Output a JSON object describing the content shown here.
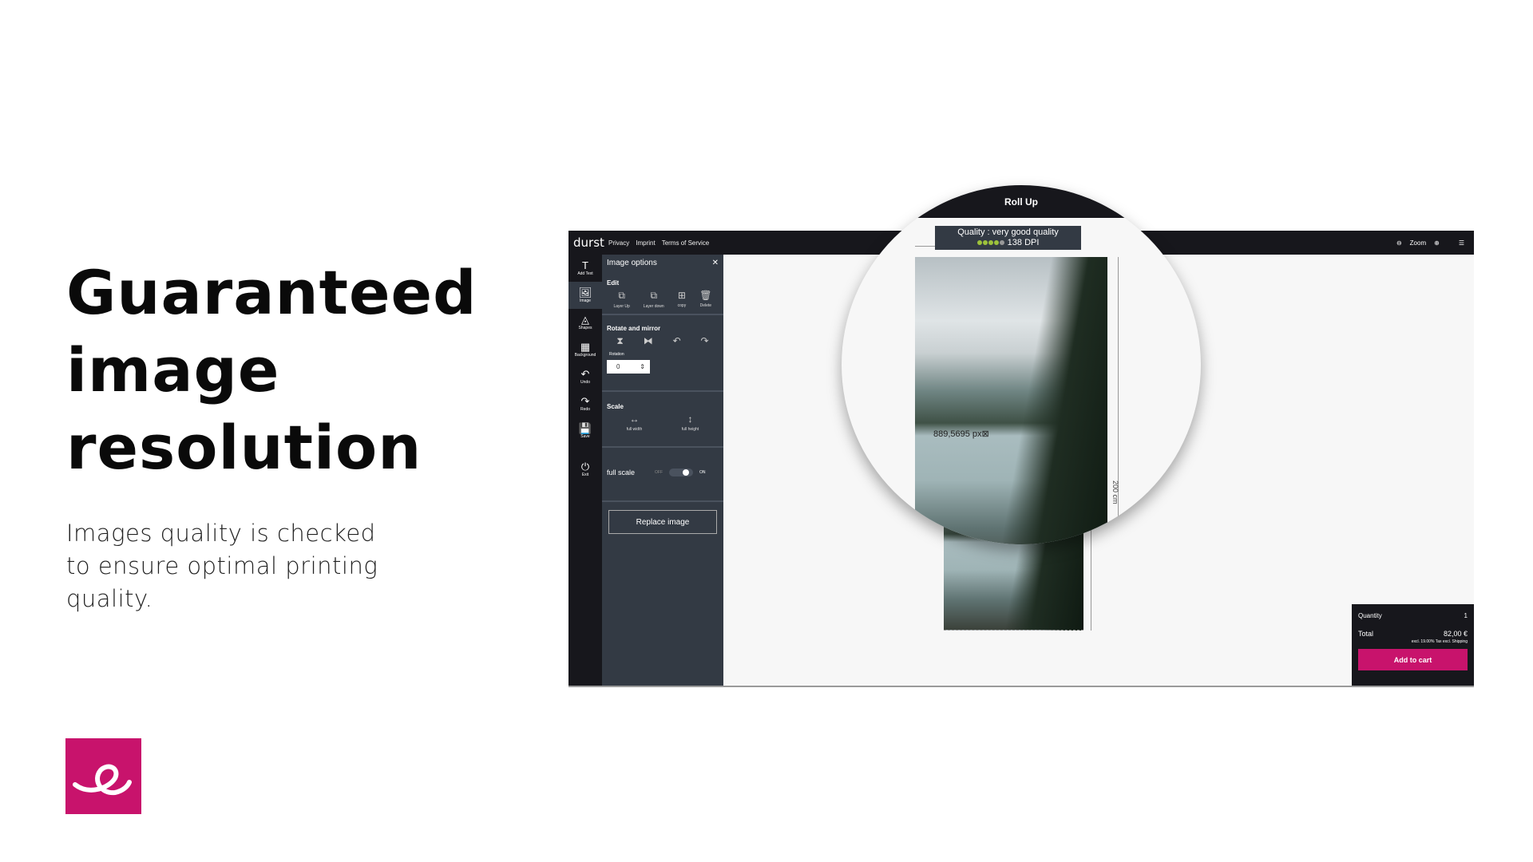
{
  "slide": {
    "headline": [
      "Guaranteed",
      "image",
      "resolution"
    ],
    "subtitle": "Images quality is checked to ensure optimal printing quality.",
    "logo_text": "e",
    "brand_color": "#c8136c"
  },
  "app": {
    "brand": "durst",
    "links": [
      "Privacy",
      "Imprint",
      "Terms of Service"
    ],
    "zoom_label": "Zoom",
    "tools": [
      {
        "label": "Add Text",
        "icon": "T"
      },
      {
        "label": "Image",
        "icon": "🖼"
      },
      {
        "label": "Shapes",
        "icon": "◬"
      },
      {
        "label": "Background",
        "icon": "▦"
      },
      {
        "label": "Undo",
        "icon": "↶"
      },
      {
        "label": "Redo",
        "icon": "↷"
      },
      {
        "label": "Save",
        "icon": "💾"
      },
      {
        "label": "Exit",
        "icon": "⏻"
      }
    ],
    "panel": {
      "title": "Image options",
      "edit_title": "Edit",
      "edit_buttons": [
        {
          "label": "Layer Up",
          "icon": "⧉"
        },
        {
          "label": "Layer down",
          "icon": "⧉"
        },
        {
          "label": "copy",
          "icon": "⊞"
        },
        {
          "label": "Delete",
          "icon": "🗑"
        }
      ],
      "rotate_title": "Rotate and mirror",
      "rotate_icons": [
        "⧗",
        "⧓",
        "↶",
        "↷"
      ],
      "rotation_label": "Rotation",
      "rotation_value": "0",
      "scale_title": "Scale",
      "scale_buttons": [
        {
          "label": "full width",
          "icon": "↔"
        },
        {
          "label": "full height",
          "icon": "↕"
        }
      ],
      "full_scale_label": "full scale",
      "off": "OFF",
      "on": "ON",
      "full_scale_on": true,
      "replace_label": "Replace image"
    },
    "product_title": "Roll Up",
    "quality": {
      "text": "Quality : very good quality",
      "dpi": "138 DPI",
      "rating": 4,
      "max": 5
    },
    "width_label": "889,5695 px⊠",
    "height_label": "200 cm",
    "cart": {
      "quantity_label": "Quantity",
      "quantity": "1",
      "total_label": "Total",
      "total": "82,00 €",
      "tax_note": "excl. 19.00% Tax excl. Shipping",
      "add_label": "Add to cart"
    }
  }
}
